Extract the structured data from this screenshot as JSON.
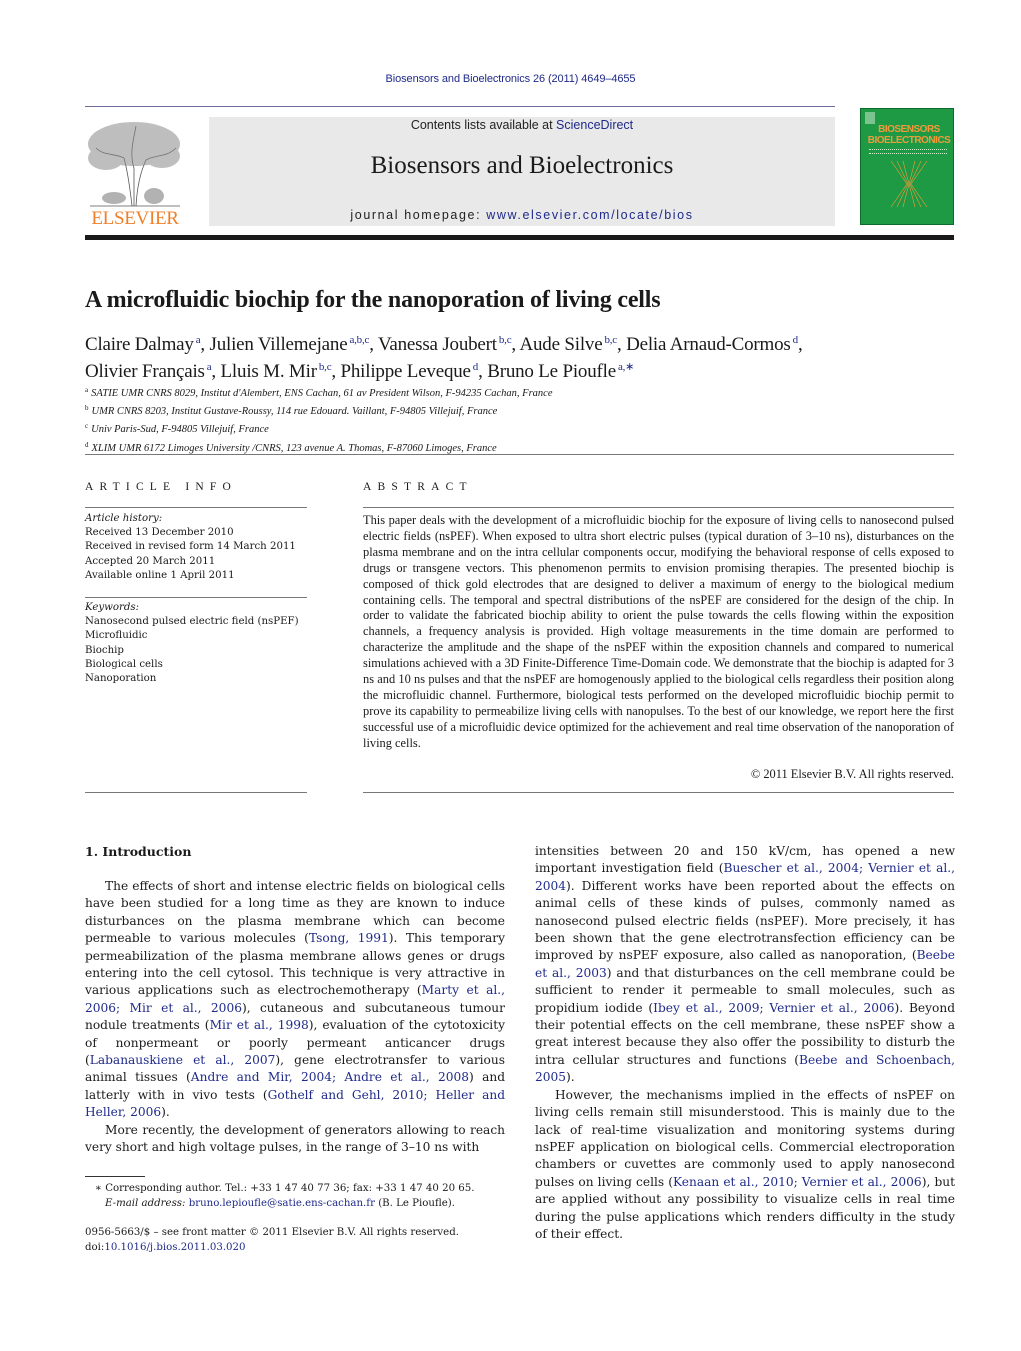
{
  "header": {
    "journal_ref": "Biosensors and Bioelectronics 26 (2011) 4649–4655",
    "contents_prefix": "Contents lists available at ",
    "contents_link": "ScienceDirect",
    "journal_title": "Biosensors and Bioelectronics",
    "homepage_prefix": "journal homepage: ",
    "homepage_link": "www.elsevier.com/locate/bios",
    "publisher_logo_text": "ELSEVIER",
    "cover_title_line1": "BIOSENSORS",
    "cover_title_line2": "BIOELECTRONICS",
    "colors": {
      "link": "#1f2a8a",
      "elsevier_orange": "#f07f2a",
      "cover_green": "#1e9a45",
      "masthead_gray": "#e9e9e9"
    }
  },
  "article": {
    "title": "A microfluidic biochip for the nanoporation of living cells",
    "authors": [
      {
        "name": "Claire Dalmay",
        "aff": "a",
        "sep": ", "
      },
      {
        "name": "Julien Villemejane",
        "aff": "a,b,c",
        "sep": ", "
      },
      {
        "name": "Vanessa Joubert",
        "aff": "b,c",
        "sep": ", "
      },
      {
        "name": "Aude Silve",
        "aff": "b,c",
        "sep": ", "
      },
      {
        "name": "Delia Arnaud-Cormos",
        "aff": "d",
        "sep": ","
      },
      {
        "name": "Olivier Français",
        "aff": "a",
        "sep": ", "
      },
      {
        "name": "Lluis M. Mir",
        "aff": "b,c",
        "sep": ", "
      },
      {
        "name": "Philippe Leveque",
        "aff": "d",
        "sep": ", "
      },
      {
        "name": "Bruno Le Pioufle",
        "aff": "a,∗",
        "sep": ""
      }
    ],
    "affiliations": [
      {
        "key": "a",
        "text": "SATIE UMR CNRS 8029, Institut d'Alembert, ENS Cachan, 61 av President Wilson, F-94235 Cachan, France"
      },
      {
        "key": "b",
        "text": "UMR CNRS 8203, Institut Gustave-Roussy, 114 rue Edouard. Vaillant, F-94805 Villejuif, France"
      },
      {
        "key": "c",
        "text": "Univ Paris-Sud, F-94805 Villejuif, France"
      },
      {
        "key": "d",
        "text": "XLIM UMR 6172 Limoges University /CNRS, 123 avenue A. Thomas, F-87060 Limoges, France"
      }
    ]
  },
  "article_info": {
    "heading": "ARTICLE INFO",
    "history_label": "Article history:",
    "history": [
      "Received 13 December 2010",
      "Received in revised form 14 March 2011",
      "Accepted 20 March 2011",
      "Available online 1 April 2011"
    ],
    "keywords_label": "Keywords:",
    "keywords": [
      "Nanosecond pulsed electric field (nsPEF)",
      "Microfluidic",
      "Biochip",
      "Biological cells",
      "Nanoporation"
    ]
  },
  "abstract": {
    "heading": "ABSTRACT",
    "text": "This paper deals with the development of a microfluidic biochip for the exposure of living cells to nanosecond pulsed electric fields (nsPEF). When exposed to ultra short electric pulses (typical duration of 3–10 ns), disturbances on the plasma membrane and on the intra cellular components occur, modifying the behavioral response of cells exposed to drugs or transgene vectors. This phenomenon permits to envision promising therapies. The presented biochip is composed of thick gold electrodes that are designed to deliver a maximum of energy to the biological medium containing cells. The temporal and spectral distributions of the nsPEF are considered for the design of the chip. In order to validate the fabricated biochip ability to orient the pulse towards the cells flowing within the exposition channels, a frequency analysis is provided. High voltage measurements in the time domain are performed to characterize the amplitude and the shape of the nsPEF within the exposition channels and compared to numerical simulations achieved with a 3D Finite-Difference Time-Domain code. We demonstrate that the biochip is adapted for 3 ns and 10 ns pulses and that the nsPEF are homogenously applied to the biological cells regardless their position along the microfluidic channel. Furthermore, biological tests performed on the developed microfluidic biochip permit to prove its capability to permeabilize living cells with nanopulses. To the best of our knowledge, we report here the first successful use of a microfluidic device optimized for the achievement and real time observation of the nanoporation of living cells.",
    "copyright": "© 2011 Elsevier B.V. All rights reserved."
  },
  "body": {
    "section_heading": "1.  Introduction",
    "left_col": {
      "p1": [
        {
          "t": "The effects of short and intense electric fields on biological cells have been studied for a long time as they are known to induce disturbances on the plasma membrane which can become permeable to various molecules ("
        },
        {
          "l": "Tsong, 1991"
        },
        {
          "t": "). This temporary permeabilization of the plasma membrane allows genes or drugs entering into the cell cytosol. This technique is very attractive in various applications such as electrochemotherapy ("
        },
        {
          "l": "Marty et al., 2006; Mir et al., 2006"
        },
        {
          "t": "), cutaneous and subcutaneous tumour nodule treatments ("
        },
        {
          "l": "Mir et al., 1998"
        },
        {
          "t": "), evaluation of the cytotoxicity of nonpermeant or poorly permeant anticancer drugs ("
        },
        {
          "l": "Labanauskiene et al., 2007"
        },
        {
          "t": "), gene electrotransfer to various animal tissues ("
        },
        {
          "l": "Andre and Mir, 2004; Andre et al., 2008"
        },
        {
          "t": ") and latterly with in vivo tests ("
        },
        {
          "l": "Gothelf and Gehl, 2010; Heller and Heller, 2006"
        },
        {
          "t": ")."
        }
      ],
      "p2": [
        {
          "t": "More recently, the development of generators allowing to reach very short and high voltage pulses, in the range of 3–10 ns with"
        }
      ]
    },
    "right_col": {
      "p1": [
        {
          "t": "intensities between 20 and 150 kV/cm, has opened a new important investigation field ("
        },
        {
          "l": "Buescher et al., 2004; Vernier et al., 2004"
        },
        {
          "t": "). Different works have been reported about the effects on animal cells of these kinds of pulses, commonly named as nanosecond pulsed electric fields (nsPEF). More precisely, it has been shown that the gene electrotransfection efficiency can be improved by nsPEF exposure, also called as nanoporation, ("
        },
        {
          "l": "Beebe et al., 2003"
        },
        {
          "t": ") and that disturbances on the cell membrane could be sufficient to render it permeable to small molecules, such as propidium iodide ("
        },
        {
          "l": "Ibey et al., 2009; Vernier et al., 2006"
        },
        {
          "t": "). Beyond their potential effects on the cell membrane, these nsPEF show a great interest because they also offer the possibility to disturb the intra cellular structures and functions ("
        },
        {
          "l": "Beebe and Schoenbach, 2005"
        },
        {
          "t": ")."
        }
      ],
      "p2": [
        {
          "t": "However, the mechanisms implied in the effects of nsPEF on living cells remain still misunderstood. This is mainly due to the lack of real-time visualization and monitoring systems during nsPEF application on biological cells. Commercial electroporation chambers or cuvettes are commonly used to apply nanosecond pulses on living cells ("
        },
        {
          "l": "Kenaan et al., 2010; Vernier et al., 2006"
        },
        {
          "t": "), but are applied without any possibility to visualize cells in real time during the pulse applications which renders difficulty in the study of their effect."
        }
      ]
    }
  },
  "footnote": {
    "marker": "∗",
    "corresponding": "Corresponding author. Tel.: +33 1 47 40 77 36; fax: +33 1 47 40 20 65.",
    "email_label": "E-mail address:",
    "email": "bruno.lepioufle@satie.ens-cachan.fr",
    "email_suffix": " (B. Le Pioufle)."
  },
  "bottom_meta": {
    "issn_line": "0956-5663/$ – see front matter © 2011 Elsevier B.V. All rights reserved.",
    "doi_prefix": "doi:",
    "doi": "10.1016/j.bios.2011.03.020"
  }
}
